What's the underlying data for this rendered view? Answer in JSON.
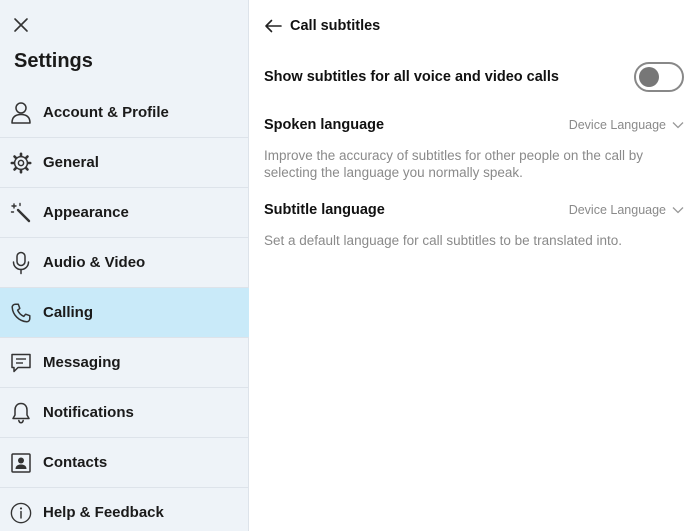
{
  "sidebar": {
    "title": "Settings",
    "items": [
      {
        "label": "Account & Profile",
        "icon": "person-icon"
      },
      {
        "label": "General",
        "icon": "gear-icon"
      },
      {
        "label": "Appearance",
        "icon": "magic-wand-icon"
      },
      {
        "label": "Audio & Video",
        "icon": "microphone-icon"
      },
      {
        "label": "Calling",
        "icon": "phone-icon",
        "active": true
      },
      {
        "label": "Messaging",
        "icon": "chat-icon"
      },
      {
        "label": "Notifications",
        "icon": "bell-icon"
      },
      {
        "label": "Contacts",
        "icon": "contact-card-icon"
      },
      {
        "label": "Help & Feedback",
        "icon": "info-icon"
      }
    ]
  },
  "main": {
    "title": "Call subtitles",
    "toggle": {
      "label": "Show subtitles for all voice and video calls",
      "state": "off"
    },
    "spoken": {
      "label": "Spoken language",
      "value": "Device Language",
      "description": "Improve the accuracy of subtitles for other people on the call by selecting the language you normally speak."
    },
    "subtitle": {
      "label": "Subtitle language",
      "value": "Device Language",
      "description": "Set a default language for call subtitles to be translated into."
    }
  },
  "colors": {
    "active_item_bg": "#c9eaf9",
    "sidebar_bg": "#eef3f8",
    "muted_text": "#8a8a8a"
  }
}
